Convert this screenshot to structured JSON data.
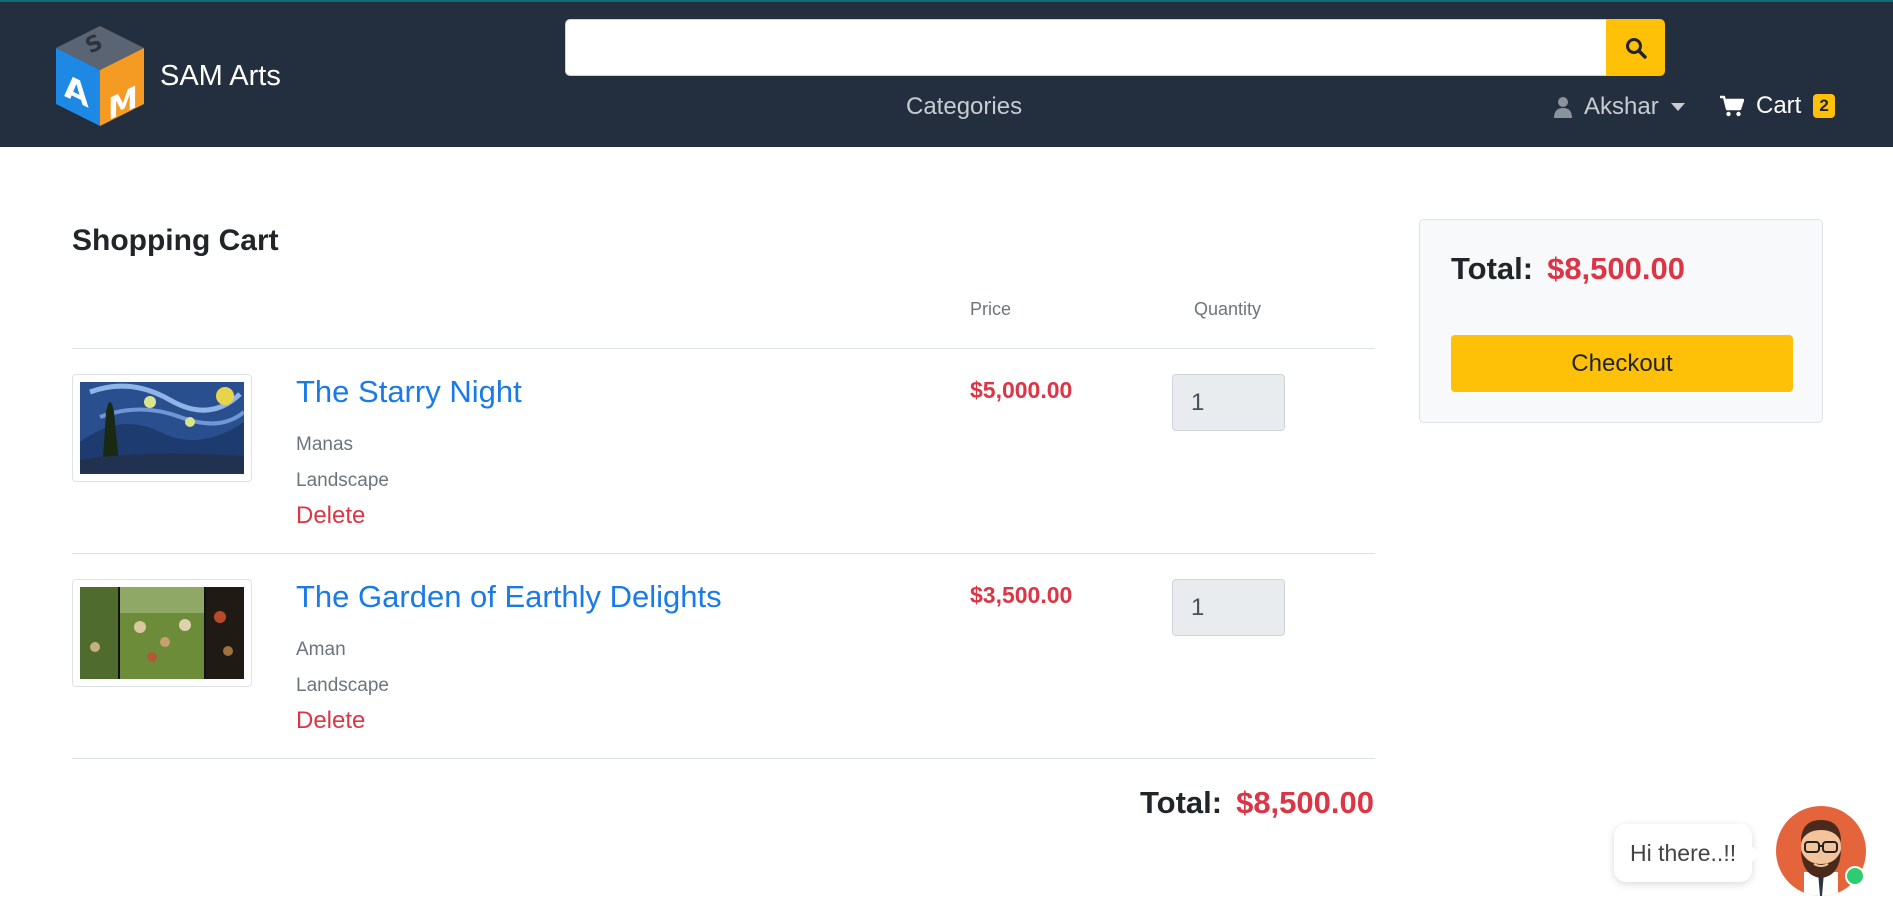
{
  "brand": {
    "name": "SAM Arts",
    "logo_icon": "sam-cube-logo"
  },
  "search": {
    "placeholder": "",
    "value": "",
    "button_icon": "search-icon"
  },
  "nav": {
    "categories": "Categories",
    "user": {
      "name": "Akshar",
      "icon": "user-icon"
    },
    "cart": {
      "label": "Cart",
      "count": "2",
      "icon": "cart-icon"
    }
  },
  "cart": {
    "title": "Shopping Cart",
    "columns": {
      "price": "Price",
      "quantity": "Quantity"
    },
    "items": [
      {
        "title": "The Starry Night",
        "artist": "Manas",
        "category": "Landscape",
        "delete_label": "Delete",
        "price": "$5,000.00",
        "quantity": "1"
      },
      {
        "title": "The Garden of Earthly Delights",
        "artist": "Aman",
        "category": "Landscape",
        "delete_label": "Delete",
        "price": "$3,500.00",
        "quantity": "1"
      }
    ],
    "total_label": "Total:",
    "total_value": "$8,500.00"
  },
  "summary": {
    "total_label": "Total:",
    "total_value": "$8,500.00",
    "checkout_label": "Checkout"
  },
  "chat": {
    "greeting": "Hi there..!!"
  },
  "colors": {
    "navbar": "#232f3e",
    "accent": "#ffc107",
    "price": "#dc3545",
    "link": "#1a7ae8"
  }
}
